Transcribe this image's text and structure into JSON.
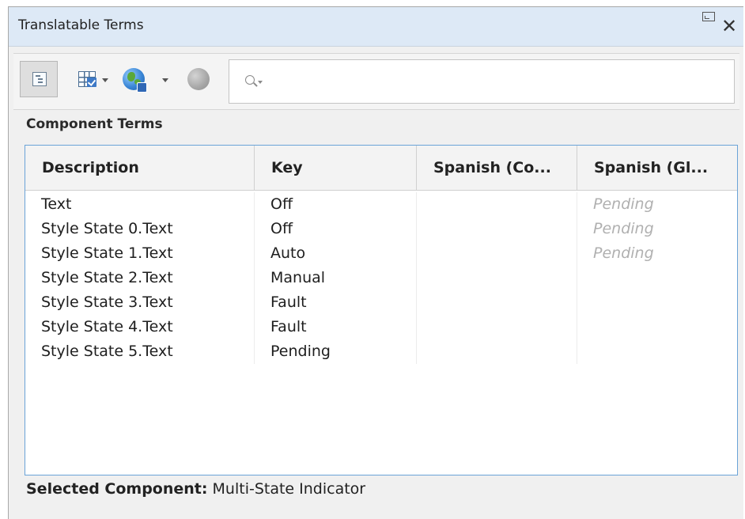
{
  "window": {
    "title": "Translatable Terms",
    "restore_icon": "restore-window-icon",
    "close_icon": "close-icon",
    "close_glyph": "✕"
  },
  "toolbar": {
    "buttons": [
      {
        "name": "tree-view",
        "icon": "tree-view-icon",
        "selected": true
      },
      {
        "name": "table-columns",
        "icon": "table-grid-check-icon",
        "has_dropdown": true
      },
      {
        "name": "translate-globe",
        "icon": "globe-icon",
        "has_dropdown": true
      },
      {
        "name": "translate-globe-disabled",
        "icon": "globe-disabled-icon"
      }
    ],
    "search": {
      "value": "",
      "placeholder": "",
      "icon": "search-icon"
    }
  },
  "section": {
    "title": "Component Terms"
  },
  "table": {
    "columns": [
      "Description",
      "Key",
      "Spanish (Co...",
      "Spanish (Gl..."
    ],
    "rows": [
      {
        "description": "Text",
        "key": "Off",
        "spanish_co": "",
        "spanish_gl": "Pending"
      },
      {
        "description": "Style State 0.Text",
        "key": "Off",
        "spanish_co": "",
        "spanish_gl": "Pending"
      },
      {
        "description": "Style State 1.Text",
        "key": "Auto",
        "spanish_co": "",
        "spanish_gl": "Pending"
      },
      {
        "description": "Style State 2.Text",
        "key": "Manual",
        "spanish_co": "",
        "spanish_gl": ""
      },
      {
        "description": "Style State 3.Text",
        "key": "Fault",
        "spanish_co": "",
        "spanish_gl": ""
      },
      {
        "description": "Style State 4.Text",
        "key": "Fault",
        "spanish_co": "",
        "spanish_gl": ""
      },
      {
        "description": "Style State 5.Text",
        "key": "Pending",
        "spanish_co": "",
        "spanish_gl": ""
      }
    ]
  },
  "footer": {
    "label": "Selected Component:",
    "value": "Multi-State Indicator"
  },
  "colors": {
    "title_bar": "#dde9f6",
    "table_border": "#6aa3d8",
    "pending_text": "#b0b0b0"
  }
}
